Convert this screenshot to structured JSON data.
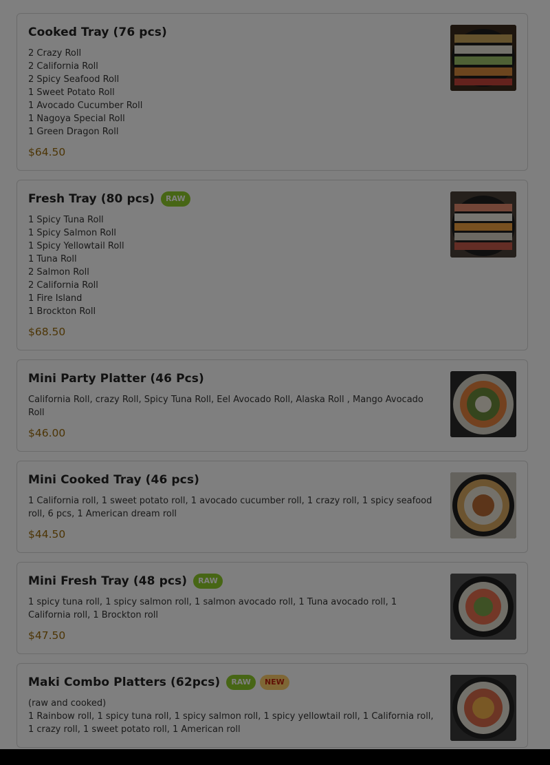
{
  "products": [
    {
      "title": "Cooked Tray (76 pcs)",
      "badges": [],
      "lines": [
        "2 Crazy Roll",
        "2 California Roll",
        "2 Spicy Seafood Roll",
        "1 Sweet Potato Roll",
        "1 Avocado Cucumber Roll",
        "1 Nagoya Special Roll",
        "1 Green Dragon Roll"
      ],
      "price": "$64.50"
    },
    {
      "title": "Fresh Tray (80 pcs)",
      "badges": [
        {
          "label": "RAW",
          "kind": "raw"
        }
      ],
      "lines": [
        "1 Spicy Tuna Roll",
        "1 Spicy Salmon Roll",
        "1 Spicy Yellowtail Roll",
        "1 Tuna Roll",
        "2 Salmon Roll",
        "2 California Roll",
        "1 Fire Island",
        "1 Brockton Roll"
      ],
      "price": "$68.50"
    },
    {
      "title": "Mini Party Platter (46 Pcs)",
      "badges": [],
      "lines": [
        "California Roll, crazy Roll, Spicy Tuna Roll, Eel Avocado Roll, Alaska Roll , Mango Avocado Roll"
      ],
      "price": "$46.00"
    },
    {
      "title": "Mini Cooked Tray (46 pcs)",
      "badges": [],
      "lines": [
        "1 California roll, 1 sweet potato roll, 1 avocado cucumber roll, 1 crazy roll, 1 spicy seafood roll, 6 pcs, 1 American dream roll"
      ],
      "price": "$44.50"
    },
    {
      "title": "Mini Fresh Tray (48 pcs)",
      "badges": [
        {
          "label": "RAW",
          "kind": "raw"
        }
      ],
      "lines": [
        "1 spicy tuna roll, 1 spicy salmon roll, 1 salmon avocado roll, 1 Tuna avocado roll, 1 California roll, 1 Brockton roll"
      ],
      "price": "$47.50"
    },
    {
      "title": "Maki Combo Platters (62pcs)",
      "badges": [
        {
          "label": "RAW",
          "kind": "raw"
        },
        {
          "label": "NEW",
          "kind": "new"
        }
      ],
      "lines": [
        "(raw and cooked)",
        "1 Rainbow roll, 1 spicy tuna roll, 1 spicy salmon roll, 1 spicy yellowtail roll, 1 California roll, 1 crazy roll, 1 sweet potato roll, 1 American roll"
      ],
      "price": ""
    }
  ],
  "colors": {
    "raw_badge": "#8fcc2b",
    "new_badge": "#ffcf6a",
    "price": "#9a6a0a",
    "overlay": "rgba(0,0,0,0.5)"
  }
}
